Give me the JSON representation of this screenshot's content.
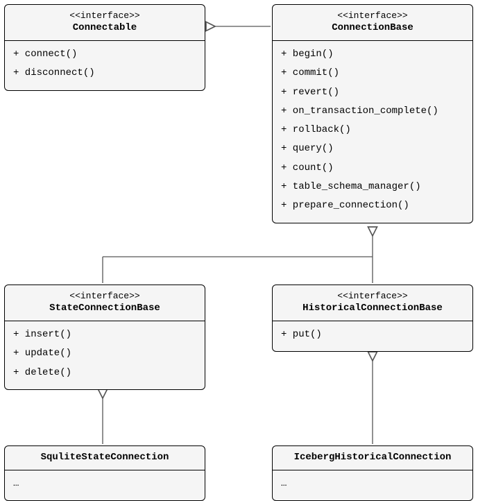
{
  "boxes": {
    "connectable": {
      "stereotype": "<<interface>>",
      "name": "Connectable",
      "members": [
        "+ connect()",
        "+ disconnect()"
      ]
    },
    "connectionBase": {
      "stereotype": "<<interface>>",
      "name": "ConnectionBase",
      "members": [
        "+ begin()",
        "+ commit()",
        "+ revert()",
        "+ on_transaction_complete()",
        "+ rollback()",
        "+ query()",
        "+ count()",
        "+ table_schema_manager()",
        "+ prepare_connection()"
      ]
    },
    "stateConnBase": {
      "stereotype": "<<interface>>",
      "name": "StateConnectionBase",
      "members": [
        "+ insert()",
        "+ update()",
        "+ delete()"
      ]
    },
    "histConnBase": {
      "stereotype": "<<interface>>",
      "name": "HistoricalConnectionBase",
      "members": [
        "+ put()"
      ]
    },
    "sqliteState": {
      "name": "SquliteStateConnection",
      "members": [
        "…"
      ]
    },
    "icebergHist": {
      "name": "IcebergHistoricalConnection",
      "members": [
        "…"
      ]
    }
  }
}
